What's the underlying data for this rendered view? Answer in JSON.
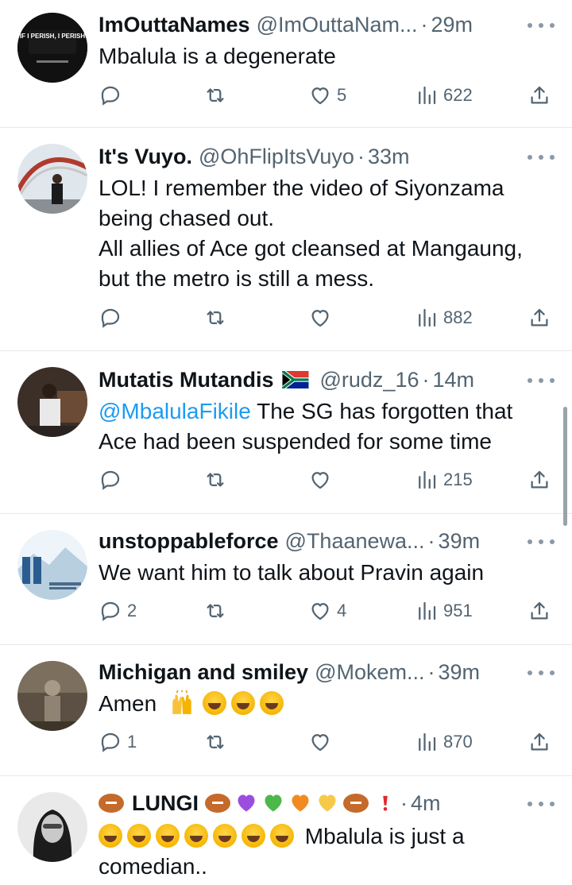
{
  "colors": {
    "text_primary": "#0f1419",
    "text_secondary": "#536471",
    "link": "#1d9bf0",
    "divider": "#e6e9eb",
    "background": "#ffffff"
  },
  "tweets": [
    {
      "name": "ImOuttaNames",
      "handle": "@ImOuttaNam...",
      "time": "29m",
      "avatar_text": "\"IF I PERISH, I PERISH\"",
      "text_lines": [
        "Mbalula is a degenerate"
      ],
      "replies": "",
      "retweets": "",
      "likes": "5",
      "views": "622"
    },
    {
      "name": "It's Vuyo.",
      "handle": "@OhFlipItsVuyo",
      "time": "33m",
      "text_lines": [
        "LOL! I remember the video of Siyonzama",
        "being chased out.",
        "All allies of Ace got cleansed at Mangaung,",
        "but the metro is still a mess."
      ],
      "replies": "",
      "retweets": "",
      "likes": "",
      "views": "882"
    },
    {
      "name": "Mutatis Mutandis",
      "handle": "@rudz_16",
      "time": "14m",
      "mention": "@MbalulaFikile",
      "text_lines": [
        " The SG has forgotten that",
        "Ace had been suspended for some time"
      ],
      "replies": "",
      "retweets": "",
      "likes": "",
      "views": "215"
    },
    {
      "name": "unstoppableforce",
      "handle": "@Thaanewa...",
      "time": "39m",
      "text_lines": [
        "We want him to talk about Pravin again"
      ],
      "replies": "2",
      "retweets": "",
      "likes": "4",
      "views": "951"
    },
    {
      "name": "Michigan and smiley",
      "handle": "@Mokem...",
      "time": "39m",
      "text_lines": [
        "Amen"
      ],
      "replies": "1",
      "retweets": "",
      "likes": "",
      "views": "870"
    },
    {
      "name": "LUNGI",
      "handle": "",
      "time": "4m",
      "text_lines": [
        "Mbalula is just a",
        "comedian.."
      ]
    }
  ],
  "separator": "·",
  "icons": [
    "reply-icon",
    "retweet-icon",
    "like-icon",
    "views-icon",
    "share-icon",
    "more-icon",
    "flag-south-africa-icon"
  ]
}
